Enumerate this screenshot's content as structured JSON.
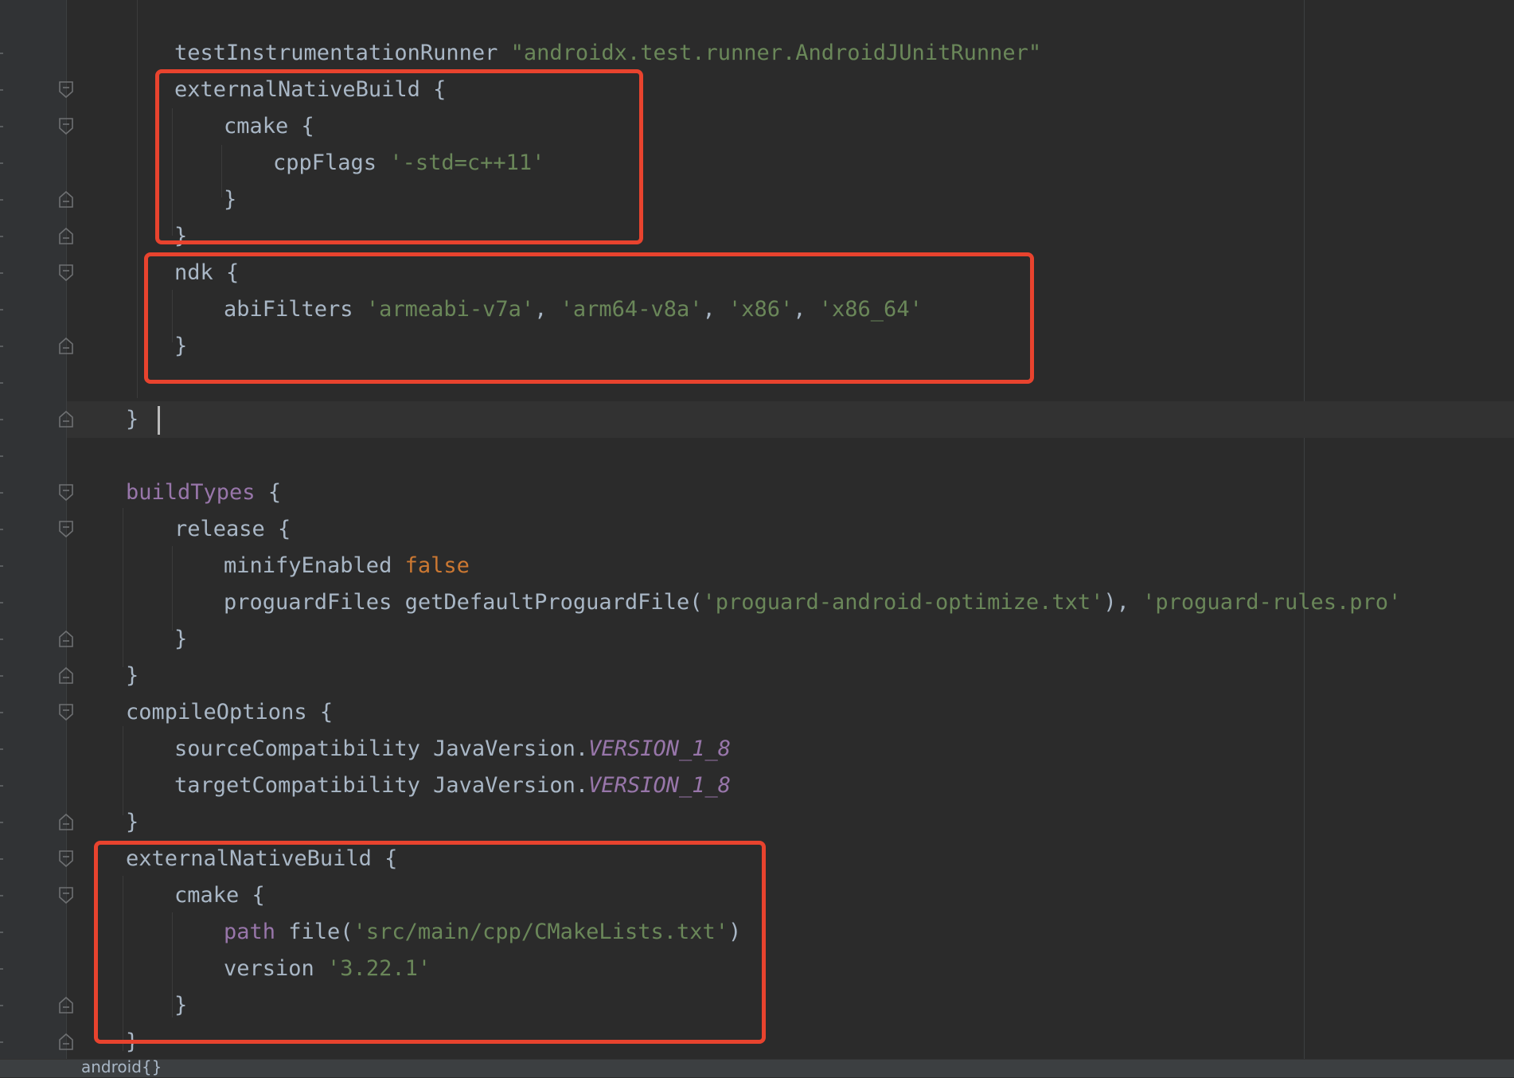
{
  "editor": {
    "lines": [
      {
        "id": "l1",
        "tokens": [
          {
            "text": "testInstrumentationRunner ",
            "type": "plain"
          },
          {
            "text": "\"androidx.test.runner.AndroidJUnitRunner\"",
            "type": "str"
          }
        ]
      },
      {
        "id": "l2",
        "tokens": [
          {
            "text": "externalNativeBuild {",
            "type": "plain"
          }
        ]
      },
      {
        "id": "l3",
        "tokens": [
          {
            "text": "cmake {",
            "type": "plain"
          }
        ]
      },
      {
        "id": "l4",
        "tokens": [
          {
            "text": "cppFlags ",
            "type": "plain"
          },
          {
            "text": "'-std=c++11'",
            "type": "str"
          }
        ]
      },
      {
        "id": "l5",
        "tokens": [
          {
            "text": "}",
            "type": "plain"
          }
        ]
      },
      {
        "id": "l6",
        "tokens": [
          {
            "text": "}",
            "type": "plain"
          }
        ]
      },
      {
        "id": "l7",
        "tokens": [
          {
            "text": "ndk {",
            "type": "plain"
          }
        ]
      },
      {
        "id": "l8",
        "tokens": [
          {
            "text": "abiFilters ",
            "type": "plain"
          },
          {
            "text": "'armeabi-v7a'",
            "type": "str"
          },
          {
            "text": ", ",
            "type": "plain"
          },
          {
            "text": "'arm64-v8a'",
            "type": "str"
          },
          {
            "text": ", ",
            "type": "plain"
          },
          {
            "text": "'x86'",
            "type": "str"
          },
          {
            "text": ", ",
            "type": "plain"
          },
          {
            "text": "'x86_64'",
            "type": "str"
          }
        ]
      },
      {
        "id": "l9",
        "tokens": [
          {
            "text": "}",
            "type": "plain"
          }
        ]
      },
      {
        "id": "l10",
        "tokens": []
      },
      {
        "id": "l11",
        "tokens": [
          {
            "text": "}",
            "type": "squiggle"
          },
          {
            "text": " ",
            "type": "plain"
          }
        ]
      },
      {
        "id": "l12",
        "tokens": []
      },
      {
        "id": "l13",
        "tokens": [
          {
            "text": "buildTypes",
            "type": "prop"
          },
          {
            "text": " {",
            "type": "plain"
          }
        ]
      },
      {
        "id": "l14",
        "tokens": [
          {
            "text": "release {",
            "type": "plain"
          }
        ]
      },
      {
        "id": "l15",
        "tokens": [
          {
            "text": "minifyEnabled ",
            "type": "plain"
          },
          {
            "text": "false",
            "type": "kw"
          }
        ]
      },
      {
        "id": "l16",
        "tokens": [
          {
            "text": "proguardFiles getDefaultProguardFile(",
            "type": "plain"
          },
          {
            "text": "'proguard-android-optimize.txt'",
            "type": "str"
          },
          {
            "text": "), ",
            "type": "plain"
          },
          {
            "text": "'proguard-rules.pro'",
            "type": "str"
          }
        ]
      },
      {
        "id": "l17",
        "tokens": [
          {
            "text": "}",
            "type": "plain"
          }
        ]
      },
      {
        "id": "l18",
        "tokens": [
          {
            "text": "}",
            "type": "plain"
          }
        ]
      },
      {
        "id": "l19",
        "tokens": [
          {
            "text": "compileOptions {",
            "type": "plain"
          }
        ]
      },
      {
        "id": "l20",
        "tokens": [
          {
            "text": "sourceCompatibility JavaVersion.",
            "type": "plain"
          },
          {
            "text": "VERSION_1_8",
            "type": "const"
          }
        ]
      },
      {
        "id": "l21",
        "tokens": [
          {
            "text": "targetCompatibility JavaVersion.",
            "type": "plain"
          },
          {
            "text": "VERSION_1_8",
            "type": "const"
          }
        ]
      },
      {
        "id": "l22",
        "tokens": [
          {
            "text": "}",
            "type": "plain"
          }
        ]
      },
      {
        "id": "l23",
        "tokens": [
          {
            "text": "externalNativeBuild {",
            "type": "plain"
          }
        ]
      },
      {
        "id": "l24",
        "tokens": [
          {
            "text": "cmake {",
            "type": "plain"
          }
        ]
      },
      {
        "id": "l25",
        "tokens": [
          {
            "text": "path",
            "type": "prop"
          },
          {
            "text": " file(",
            "type": "plain"
          },
          {
            "text": "'src/main/cpp/CMakeLists.txt'",
            "type": "str"
          },
          {
            "text": ")",
            "type": "plain"
          }
        ]
      },
      {
        "id": "l26",
        "tokens": [
          {
            "text": "version ",
            "type": "plain"
          },
          {
            "text": "'3.22.1'",
            "type": "str"
          }
        ]
      },
      {
        "id": "l27",
        "tokens": [
          {
            "text": "}",
            "type": "plain"
          }
        ]
      },
      {
        "id": "l28",
        "tokens": [
          {
            "text": "}",
            "type": "plain"
          }
        ]
      }
    ]
  },
  "breadcrumb": {
    "text": "android{}"
  },
  "colors": {
    "highlight": "#e8432e",
    "string": "#6a8759",
    "keyword": "#cc7832",
    "property": "#9876aa",
    "text": "#a9b7c6"
  }
}
